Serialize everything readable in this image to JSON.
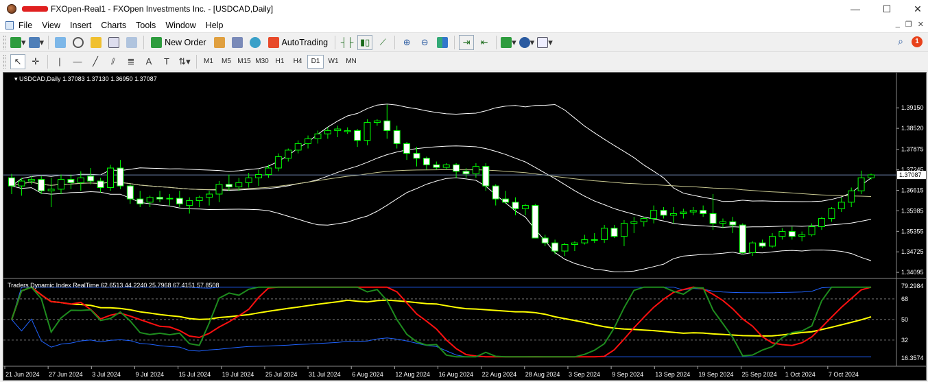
{
  "window": {
    "title": "FXOpen-Real1 - FXOpen Investments Inc. - [USDCAD,Daily]",
    "minimize": "—",
    "maximize": "☐",
    "close": "✕"
  },
  "menu": [
    "File",
    "View",
    "Insert",
    "Charts",
    "Tools",
    "Window",
    "Help"
  ],
  "toolbar": {
    "new_order": "New Order",
    "autotrading": "AutoTrading",
    "notification_count": "1"
  },
  "timeframes": [
    "M1",
    "M5",
    "M15",
    "M30",
    "H1",
    "H4",
    "D1",
    "W1",
    "MN"
  ],
  "active_timeframe": "D1",
  "chart_data": {
    "type": "candlestick",
    "symbol_label": "USDCAD,Daily",
    "ohlc_label": "1.37083 1.37130 1.36950 1.37087",
    "price_ticks": [
      "1.39150",
      "1.38520",
      "1.37875",
      "1.37245",
      "1.36615",
      "1.35985",
      "1.35355",
      "1.34725",
      "1.34095"
    ],
    "current_price": "1.37087",
    "ylim": [
      1.3395,
      1.3985
    ],
    "candles": [
      [
        1.37,
        1.3712,
        1.365,
        1.3675
      ],
      [
        1.3675,
        1.37,
        1.3645,
        1.369
      ],
      [
        1.369,
        1.3705,
        1.368,
        1.3695
      ],
      [
        1.3695,
        1.3705,
        1.365,
        1.366
      ],
      [
        1.366,
        1.37,
        1.361,
        1.3665
      ],
      [
        1.3665,
        1.371,
        1.365,
        1.3695
      ],
      [
        1.3695,
        1.371,
        1.3665,
        1.3685
      ],
      [
        1.3685,
        1.372,
        1.366,
        1.37
      ],
      [
        1.3705,
        1.373,
        1.368,
        1.369
      ],
      [
        1.369,
        1.37,
        1.3655,
        1.367
      ],
      [
        1.367,
        1.374,
        1.366,
        1.373
      ],
      [
        1.373,
        1.3755,
        1.3665,
        1.3675
      ],
      [
        1.3675,
        1.368,
        1.362,
        1.3635
      ],
      [
        1.3635,
        1.366,
        1.361,
        1.362
      ],
      [
        1.3625,
        1.3645,
        1.361,
        1.364
      ],
      [
        1.364,
        1.366,
        1.3625,
        1.3635
      ],
      [
        1.3635,
        1.365,
        1.3615,
        1.3637
      ],
      [
        1.3637,
        1.366,
        1.361,
        1.362
      ],
      [
        1.3615,
        1.364,
        1.359,
        1.363
      ],
      [
        1.363,
        1.3645,
        1.361,
        1.364
      ],
      [
        1.364,
        1.366,
        1.3615,
        1.365
      ],
      [
        1.365,
        1.369,
        1.3625,
        1.368
      ],
      [
        1.368,
        1.371,
        1.366,
        1.3672
      ],
      [
        1.3672,
        1.37,
        1.366,
        1.3685
      ],
      [
        1.3685,
        1.3715,
        1.367,
        1.37
      ],
      [
        1.37,
        1.3725,
        1.3675,
        1.371
      ],
      [
        1.371,
        1.374,
        1.37,
        1.373
      ],
      [
        1.373,
        1.3775,
        1.372,
        1.3765
      ],
      [
        1.376,
        1.379,
        1.375,
        1.3785
      ],
      [
        1.3785,
        1.3815,
        1.3775,
        1.3805
      ],
      [
        1.3805,
        1.383,
        1.379,
        1.382
      ],
      [
        1.382,
        1.3845,
        1.3805,
        1.3835
      ],
      [
        1.3835,
        1.3855,
        1.382,
        1.3845
      ],
      [
        1.3845,
        1.386,
        1.3825,
        1.385
      ],
      [
        1.3842,
        1.3855,
        1.3835,
        1.3845
      ],
      [
        1.3845,
        1.385,
        1.3795,
        1.3815
      ],
      [
        1.3815,
        1.388,
        1.38,
        1.387
      ],
      [
        1.387,
        1.388,
        1.386,
        1.3875
      ],
      [
        1.3875,
        1.3925,
        1.382,
        1.3845
      ],
      [
        1.3845,
        1.386,
        1.379,
        1.3805
      ],
      [
        1.3805,
        1.381,
        1.3755,
        1.3775
      ],
      [
        1.3775,
        1.3795,
        1.3735,
        1.376
      ],
      [
        1.376,
        1.3765,
        1.3725,
        1.374
      ],
      [
        1.374,
        1.375,
        1.3725,
        1.3732
      ],
      [
        1.3732,
        1.3745,
        1.3725,
        1.374
      ],
      [
        1.374,
        1.3745,
        1.37,
        1.372
      ],
      [
        1.372,
        1.373,
        1.37,
        1.3712
      ],
      [
        1.3712,
        1.3745,
        1.37,
        1.3735
      ],
      [
        1.3735,
        1.3745,
        1.366,
        1.3675
      ],
      [
        1.3675,
        1.368,
        1.3615,
        1.3635
      ],
      [
        1.3635,
        1.366,
        1.362,
        1.3625
      ],
      [
        1.3625,
        1.364,
        1.3585,
        1.3605
      ],
      [
        1.3605,
        1.362,
        1.3585,
        1.3615
      ],
      [
        1.3615,
        1.362,
        1.3515,
        1.3515
      ],
      [
        1.3515,
        1.3525,
        1.349,
        1.35
      ],
      [
        1.35,
        1.351,
        1.3465,
        1.3475
      ],
      [
        1.3475,
        1.35,
        1.346,
        1.3495
      ],
      [
        1.3495,
        1.3505,
        1.3475,
        1.35
      ],
      [
        1.35,
        1.3525,
        1.3495,
        1.351
      ],
      [
        1.351,
        1.353,
        1.35,
        1.351
      ],
      [
        1.351,
        1.3555,
        1.35,
        1.3545
      ],
      [
        1.3545,
        1.3555,
        1.3515,
        1.352
      ],
      [
        1.352,
        1.357,
        1.349,
        1.356
      ],
      [
        1.356,
        1.358,
        1.353,
        1.3565
      ],
      [
        1.3565,
        1.358,
        1.355,
        1.3575
      ],
      [
        1.3575,
        1.3615,
        1.356,
        1.36
      ],
      [
        1.36,
        1.361,
        1.3575,
        1.3585
      ],
      [
        1.3585,
        1.361,
        1.356,
        1.359
      ],
      [
        1.359,
        1.3605,
        1.3575,
        1.3595
      ],
      [
        1.3595,
        1.361,
        1.3585,
        1.36
      ],
      [
        1.36,
        1.3615,
        1.358,
        1.359
      ],
      [
        1.359,
        1.365,
        1.354,
        1.356
      ],
      [
        1.356,
        1.3575,
        1.3545,
        1.3565
      ],
      [
        1.3565,
        1.358,
        1.353,
        1.3555
      ],
      [
        1.3555,
        1.356,
        1.3465,
        1.347
      ],
      [
        1.347,
        1.3505,
        1.346,
        1.35
      ],
      [
        1.35,
        1.351,
        1.3485,
        1.349
      ],
      [
        1.349,
        1.353,
        1.3485,
        1.352
      ],
      [
        1.352,
        1.3545,
        1.351,
        1.3535
      ],
      [
        1.3535,
        1.355,
        1.351,
        1.352
      ],
      [
        1.352,
        1.3535,
        1.3505,
        1.3525
      ],
      [
        1.3525,
        1.356,
        1.352,
        1.355
      ],
      [
        1.355,
        1.358,
        1.354,
        1.3575
      ],
      [
        1.3575,
        1.361,
        1.3565,
        1.3605
      ],
      [
        1.3605,
        1.364,
        1.3595,
        1.3625
      ],
      [
        1.3625,
        1.367,
        1.361,
        1.366
      ],
      [
        1.366,
        1.3722,
        1.365,
        1.37
      ],
      [
        1.37,
        1.3713,
        1.3695,
        1.3709
      ]
    ],
    "indicator": {
      "label": "Traders Dynamic Index RealTime 62.6513 44.2240 25.7968 67.4151 57.8508",
      "ticks": [
        "79.2984",
        "68",
        "50",
        "32",
        "16.3574"
      ],
      "ylim": [
        16.3574,
        79.2984
      ],
      "levels": [
        68,
        50,
        32
      ]
    },
    "x_labels": [
      "21 Jun 2024",
      "27 Jun 2024",
      "3 Jul 2024",
      "9 Jul 2024",
      "15 Jul 2024",
      "19 Jul 2024",
      "25 Jul 2024",
      "31 Jul 2024",
      "6 Aug 2024",
      "12 Aug 2024",
      "16 Aug 2024",
      "22 Aug 2024",
      "28 Aug 2024",
      "3 Sep 2024",
      "9 Sep 2024",
      "13 Sep 2024",
      "19 Sep 2024",
      "25 Sep 2024",
      "1 Oct 2024",
      "7 Oct 2024"
    ],
    "colors": {
      "bull": "#00ff00",
      "bear_body": "#ffffff",
      "band": "#ffffff",
      "ma_yellow": "#c8c890",
      "tdi_green": "#1e8c1e",
      "tdi_red": "#ff1010",
      "tdi_yellow": "#ffff00",
      "tdi_blue": "#1f63ff"
    }
  }
}
